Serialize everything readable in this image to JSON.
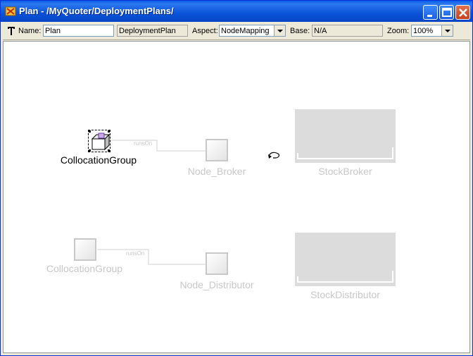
{
  "window": {
    "title": "Plan - /MyQuoter/DeploymentPlans/",
    "colors": {
      "titlebar": "#0a53d8",
      "close": "#c5421c",
      "dim_node": "#c8c8c8",
      "big_box": "#dcdcdc"
    }
  },
  "toolbar": {
    "name_label": "Name:",
    "name_value": "Plan",
    "type_value": "DeploymentPlan",
    "aspect_label": "Aspect:",
    "aspect_value": "NodeMapping",
    "base_label": "Base:",
    "base_value": "N/A",
    "zoom_label": "Zoom:",
    "zoom_value": "100%"
  },
  "diagram": {
    "collocation_group_1": "CollocationGroup",
    "node_broker": "Node_Broker",
    "stock_broker": "StockBroker",
    "collocation_group_2": "CollocationGroup",
    "node_distributor": "Node_Distributor",
    "stock_distributor": "StockDistributor",
    "connection_1": "runsOn",
    "connection_2": "runsOn"
  }
}
